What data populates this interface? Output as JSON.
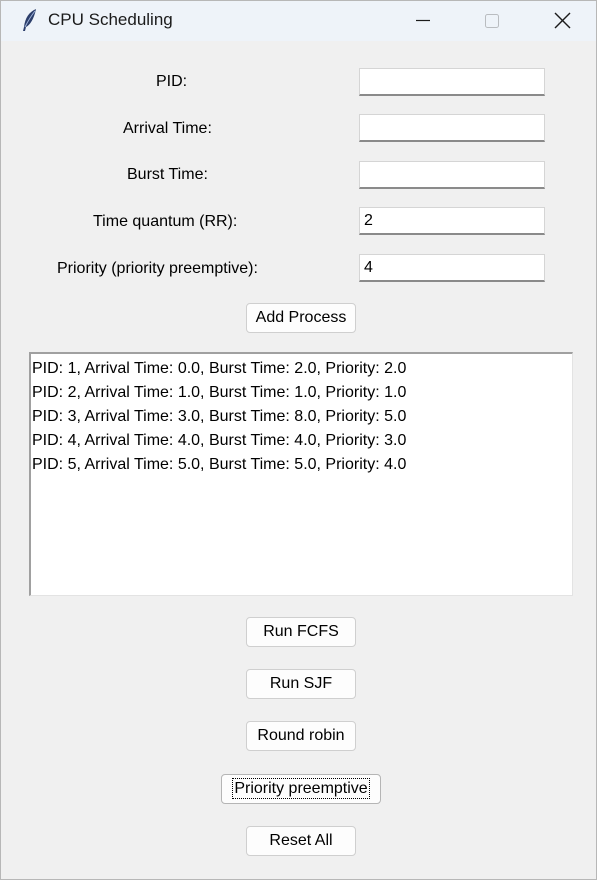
{
  "window": {
    "title": "CPU Scheduling",
    "icons": {
      "app": "feather-icon",
      "minimize": "minimize-icon",
      "maximize": "maximize-icon",
      "close": "close-icon"
    }
  },
  "form": {
    "pid_label": "PID:",
    "pid_value": "",
    "arrival_label": "Arrival Time:",
    "arrival_value": "",
    "burst_label": "Burst Time:",
    "burst_value": "",
    "quantum_label": "Time quantum (RR):",
    "quantum_value": "2",
    "priority_label": "Priority (priority preemptive):",
    "priority_value": "4",
    "add_button": "Add Process"
  },
  "process_list": [
    "PID: 1, Arrival Time: 0.0, Burst Time: 2.0, Priority: 2.0",
    "PID: 2, Arrival Time: 1.0, Burst Time: 1.0, Priority: 1.0",
    "PID: 3, Arrival Time: 3.0, Burst Time: 8.0, Priority: 5.0",
    "PID: 4, Arrival Time: 4.0, Burst Time: 4.0, Priority: 3.0",
    "PID: 5, Arrival Time: 5.0, Burst Time: 5.0, Priority: 4.0"
  ],
  "actions": {
    "fcfs": "Run FCFS",
    "sjf": "Run SJF",
    "round_robin": "Round robin",
    "priority_preemptive": "Priority preemptive",
    "reset": "Reset All"
  }
}
